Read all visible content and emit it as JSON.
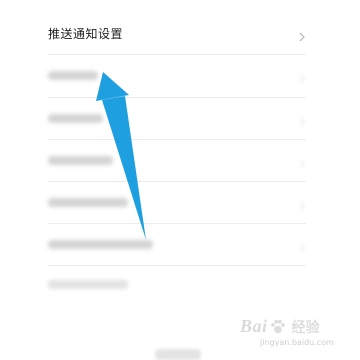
{
  "settings": {
    "push_item": {
      "label": "推送通知设置"
    }
  },
  "colors": {
    "arrow": "#1E9FE0",
    "divider": "#ECECEC",
    "text": "#222222"
  },
  "watermark": {
    "brand": "Bai",
    "brand_suffix": "经验",
    "url": "jingyan.baidu.com"
  }
}
